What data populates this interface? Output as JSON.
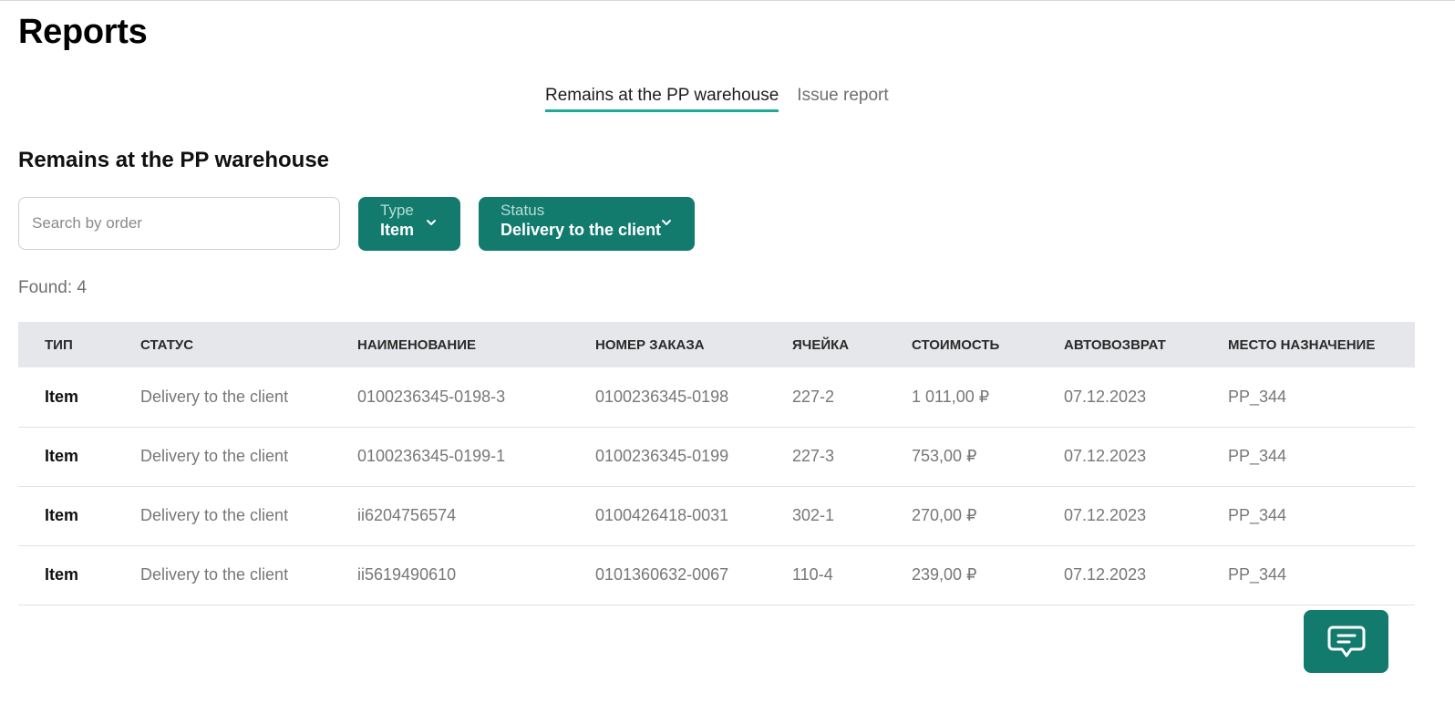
{
  "header": {
    "title": "Reports"
  },
  "tabs": [
    {
      "label": "Remains at the PP warehouse",
      "active": true
    },
    {
      "label": "Issue report",
      "active": false
    }
  ],
  "section": {
    "title": "Remains at the PP warehouse"
  },
  "search": {
    "placeholder": "Search by order",
    "value": ""
  },
  "filters": {
    "type": {
      "label": "Type",
      "value": "Item"
    },
    "status": {
      "label": "Status",
      "value": "Delivery to the client"
    }
  },
  "found": "Found: 4",
  "table": {
    "columns": [
      "ТИП",
      "СТАТУС",
      "НАИМЕНОВАНИЕ",
      "НОМЕР ЗАКАЗА",
      "ЯЧЕЙКА",
      "СТОИМОСТЬ",
      "АВТОВОЗВРАТ",
      "МЕСТО НАЗНАЧЕНИЕ"
    ],
    "rows": [
      [
        "Item",
        "Delivery to the client",
        "0100236345-0198-3",
        "0100236345-0198",
        "227-2",
        "1 011,00 ₽",
        "07.12.2023",
        "PP_344"
      ],
      [
        "Item",
        "Delivery to the client",
        "0100236345-0199-1",
        "0100236345-0199",
        "227-3",
        "753,00 ₽",
        "07.12.2023",
        "PP_344"
      ],
      [
        "Item",
        "Delivery to the client",
        "ii6204756574",
        "0100426418-0031",
        "302-1",
        "270,00 ₽",
        "07.12.2023",
        "PP_344"
      ],
      [
        "Item",
        "Delivery to the client",
        "ii5619490610",
        "0101360632-0067",
        "110-4",
        "239,00 ₽",
        "07.12.2023",
        "PP_344"
      ]
    ]
  },
  "chat": {
    "icon": "chat-icon"
  },
  "colors": {
    "accent": "#137a6e",
    "tab_underline": "#20a997",
    "header_bg": "#e6e7ea"
  }
}
